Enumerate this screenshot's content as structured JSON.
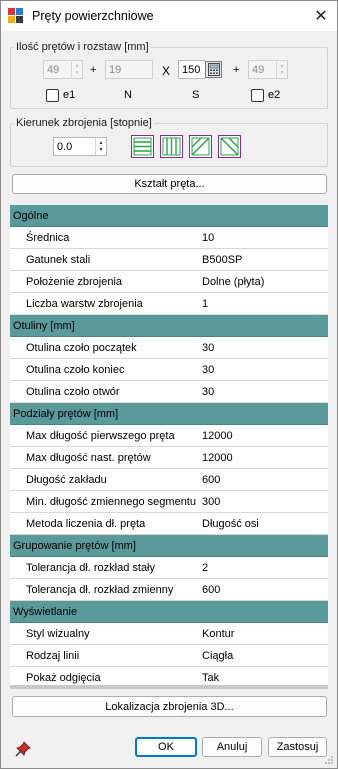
{
  "window": {
    "title": "Pręty powierzchniowe",
    "close_glyph": "✕"
  },
  "bars_group": {
    "legend": "Ilość prętów i rozstaw [mm]",
    "field1": "49",
    "field2": "19",
    "field3": "150",
    "field4": "49",
    "plus1": "+",
    "x_sign": "X",
    "plus2": "+",
    "chk_e1": "e1",
    "lbl_n": "N",
    "lbl_s": "S",
    "chk_e2": "e2"
  },
  "direction_group": {
    "legend": "Kierunek zbrojenia [stopnie]",
    "angle": "0.0"
  },
  "shape_button": "Kształt pręta...",
  "properties": [
    {
      "category": "Ogólne",
      "rows": [
        {
          "k": "Średnica",
          "v": "10"
        },
        {
          "k": "Gatunek stali",
          "v": "B500SP"
        },
        {
          "k": "Położenie zbrojenia",
          "v": "Dolne (płyta)"
        },
        {
          "k": "Liczba warstw zbrojenia",
          "v": "1"
        }
      ]
    },
    {
      "category": "Otuliny [mm]",
      "rows": [
        {
          "k": "Otulina czoło początek",
          "v": "30"
        },
        {
          "k": "Otulina czoło koniec",
          "v": "30"
        },
        {
          "k": "Otulina czoło otwór",
          "v": "30"
        }
      ]
    },
    {
      "category": "Podziały prętów [mm]",
      "rows": [
        {
          "k": "Max długość pierwszego pręta",
          "v": "12000"
        },
        {
          "k": "Max długość nast. prętów",
          "v": "12000"
        },
        {
          "k": "Długość zakładu",
          "v": "600"
        },
        {
          "k": "Min. długość zmiennego segmentu",
          "v": "300"
        },
        {
          "k": "Metoda liczenia dł. pręta",
          "v": "Długość osi"
        }
      ]
    },
    {
      "category": "Grupowanie prętów [mm]",
      "rows": [
        {
          "k": "Tolerancja dł. rozkład stały",
          "v": "2"
        },
        {
          "k": "Tolerancja dł. rozkład zmienny",
          "v": "600"
        }
      ]
    },
    {
      "category": "Wyświetlanie",
      "rows": [
        {
          "k": "Styl wizualny",
          "v": "Kontur"
        },
        {
          "k": "Rodzaj linii",
          "v": "Ciągła"
        },
        {
          "k": "Pokaż odgięcia",
          "v": "Tak"
        }
      ]
    }
  ],
  "localize_button": "Lokalizacja zbrojenia 3D...",
  "footer": {
    "ok": "OK",
    "cancel": "Anuluj",
    "apply": "Zastosuj"
  },
  "colors": {
    "category_bg": "#5a9a9a",
    "direction_icon": "#22a845",
    "direction_border": "#8a2a8a",
    "default_button_border": "#0078d4"
  }
}
